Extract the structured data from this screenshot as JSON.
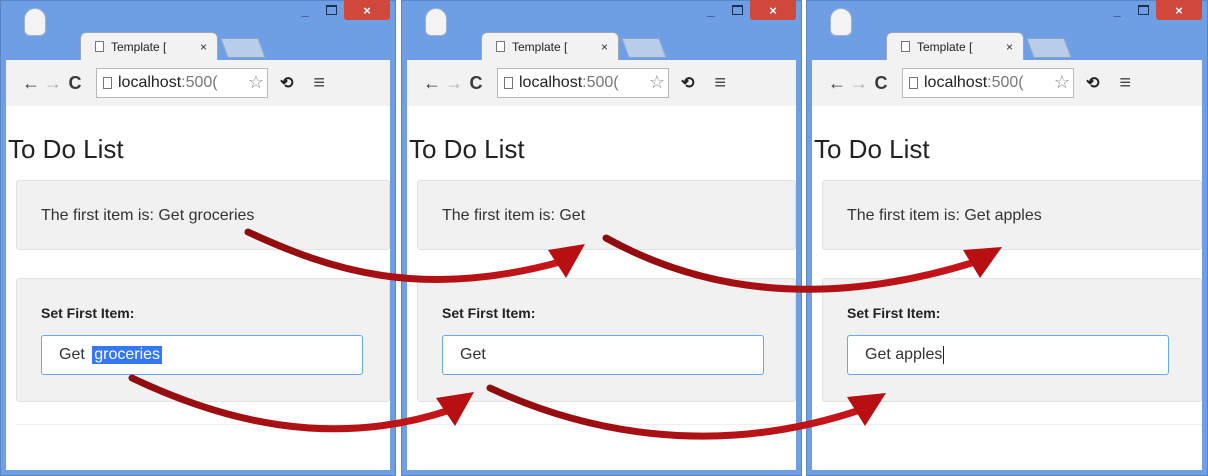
{
  "windows": [
    {
      "tab_title": "Template [",
      "tab_close": "×",
      "url_host": "localhost",
      "url_port": ":500(",
      "heading": "To Do List",
      "item_text": "The first item is: Get groceries",
      "form_label": "Set First Item:",
      "input_before": "Get ",
      "input_selected": "groceries"
    },
    {
      "tab_title": "Template [",
      "tab_close": "×",
      "url_host": "localhost",
      "url_port": ":500(",
      "heading": "To Do List",
      "item_text": "The first item is: Get",
      "form_label": "Set First Item:",
      "input_value": "Get"
    },
    {
      "tab_title": "Template [",
      "tab_close": "×",
      "url_host": "localhost",
      "url_port": ":500(",
      "heading": "To Do List",
      "item_text": "The first item is: Get apples",
      "form_label": "Set First Item:",
      "input_value": "Get apples"
    }
  ],
  "window_controls": {
    "minimize": "_",
    "close": "×"
  },
  "toolbar_icons": [
    "back-arrow",
    "forward-arrow",
    "reload",
    "star",
    "extension",
    "menu"
  ],
  "colors": {
    "frame": "#6e9fe4",
    "close_button": "#d0473b",
    "arrow": "#b80f12",
    "selection": "#3478f6"
  }
}
